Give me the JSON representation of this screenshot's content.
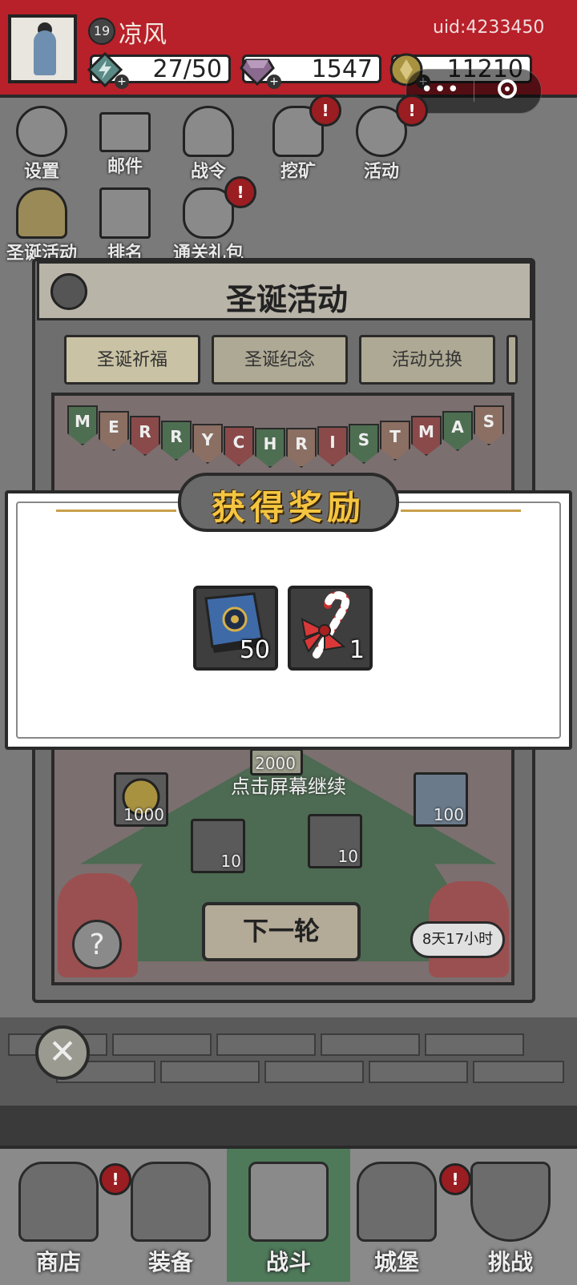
{
  "player": {
    "level": "19",
    "name": "凉风",
    "uid": "uid:4233450"
  },
  "resources": {
    "energy": "27/50",
    "gems": "1547",
    "coins": "11210",
    "plus": "+"
  },
  "capsule": {
    "dots": "•••"
  },
  "menu": [
    {
      "label": "设置",
      "icon": "gear-icon"
    },
    {
      "label": "邮件",
      "icon": "mail-icon"
    },
    {
      "label": "战令",
      "icon": "battle-pass-icon"
    },
    {
      "label": "挖矿",
      "icon": "mining-icon"
    },
    {
      "label": "活动",
      "icon": "activity-icon"
    },
    {
      "label": "圣诞活动",
      "icon": "christmas-bell-icon"
    },
    {
      "label": "排名",
      "icon": "ranking-icon"
    },
    {
      "label": "通关礼包",
      "icon": "gift-bag-icon"
    }
  ],
  "badge": "!",
  "panel": {
    "title": "圣诞活动",
    "tabs": [
      "圣诞祈福",
      "圣诞纪念",
      "活动兑换"
    ],
    "banner": [
      "M",
      "E",
      "R",
      "R",
      "Y",
      "C",
      "H",
      "R",
      "I",
      "S",
      "T",
      "M",
      "A",
      "S"
    ],
    "items": [
      {
        "count": "2000"
      },
      {
        "count": "1000"
      },
      {
        "count": "10"
      },
      {
        "count": "10"
      },
      {
        "count": "100"
      }
    ],
    "next_round": "下一轮",
    "timer": "8天17小时",
    "help": "?"
  },
  "popup": {
    "title": "获得奖励",
    "rewards": [
      {
        "name": "book-icon",
        "count": "50"
      },
      {
        "name": "candy-cane-icon",
        "count": "1"
      }
    ],
    "continue_hint": "点击屏幕继续"
  },
  "close": "✕",
  "nav": [
    {
      "label": "商店"
    },
    {
      "label": "装备"
    },
    {
      "label": "战斗"
    },
    {
      "label": "城堡"
    },
    {
      "label": "挑战"
    }
  ],
  "colors": {
    "accent": "#b8202a",
    "title_gold": "#f5c542",
    "active_nav": "#4e7a5a"
  }
}
